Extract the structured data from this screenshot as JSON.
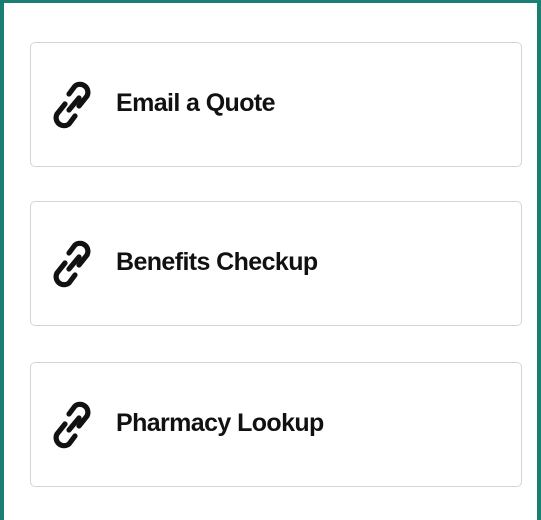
{
  "links": [
    {
      "label": "Email a Quote",
      "icon": "link-icon"
    },
    {
      "label": "Benefits Checkup",
      "icon": "link-icon"
    },
    {
      "label": "Pharmacy Lookup",
      "icon": "link-icon"
    }
  ],
  "colors": {
    "frame_border": "#1a7f72",
    "card_border": "#d4d4d4",
    "text": "#111111",
    "background": "#ffffff"
  }
}
